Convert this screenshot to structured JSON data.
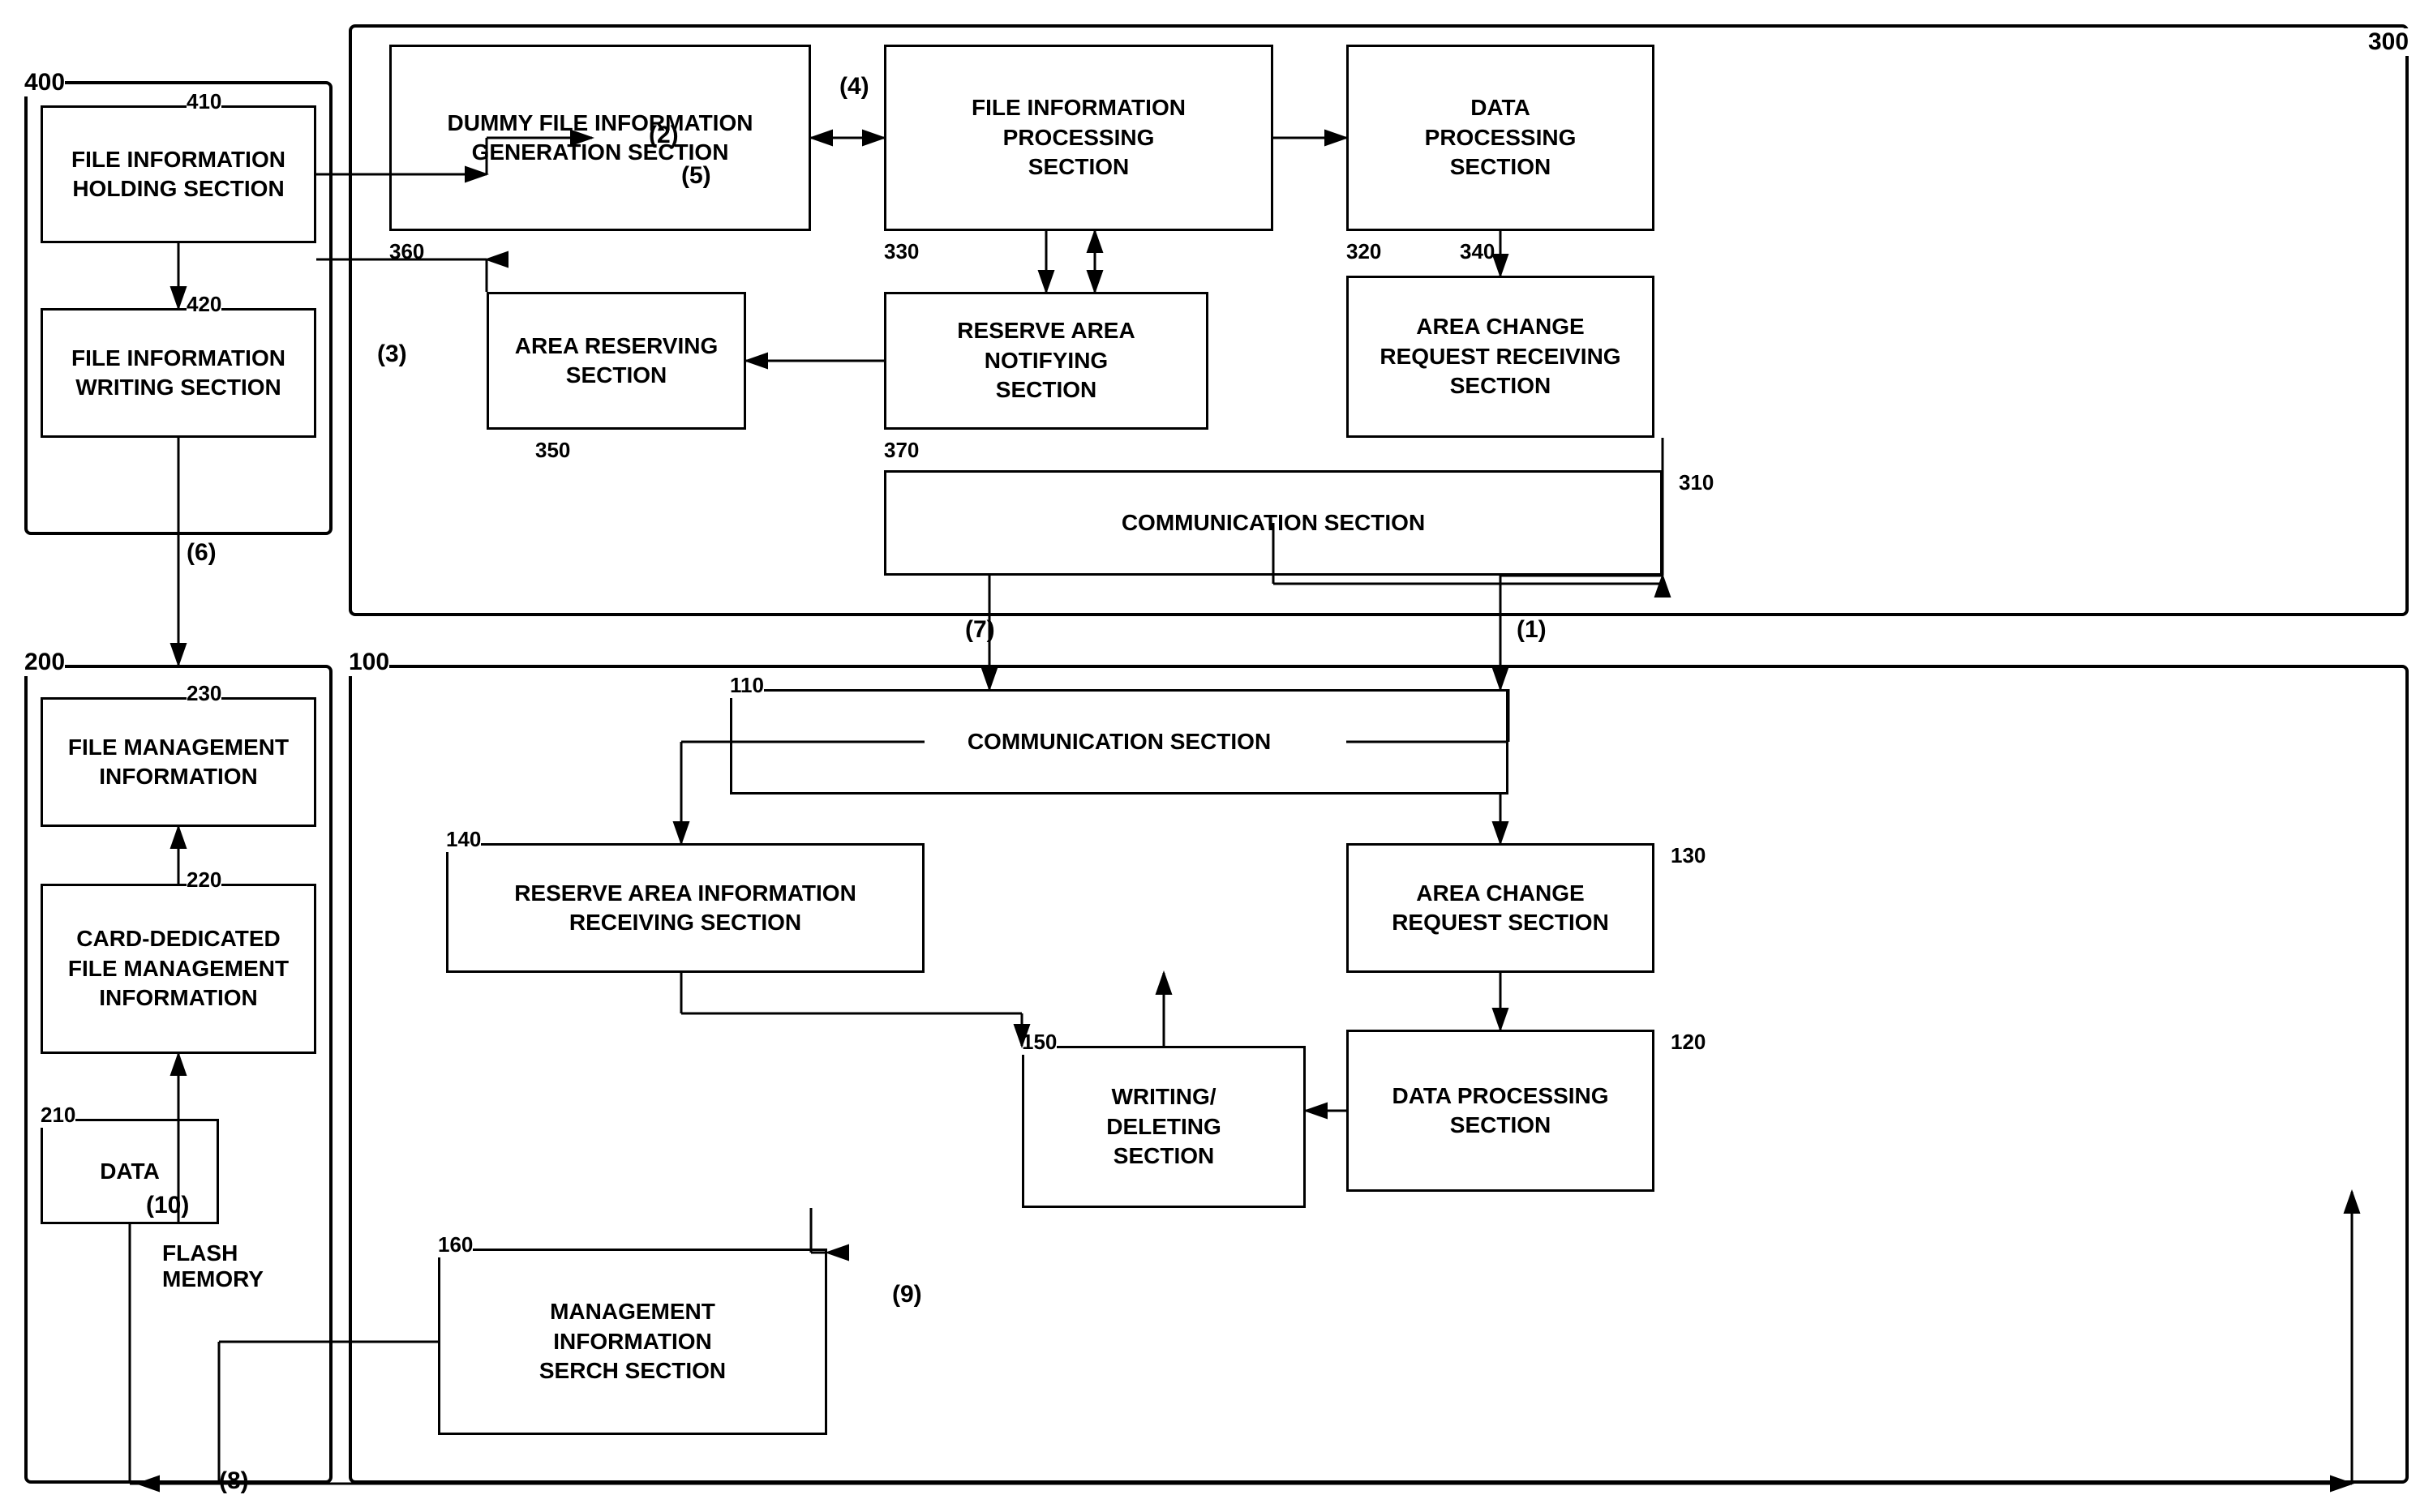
{
  "boxes": {
    "dummy_file": {
      "label": "DUMMY FILE\nINFORMATION\nGENERATION SECTION",
      "id": "360"
    },
    "file_info_processing": {
      "label": "FILE INFORMATION\nPROCESSING\nSECTION",
      "id": "330"
    },
    "data_processing_300": {
      "label": "DATA\nPROCESSING\nSECTION",
      "id": "320"
    },
    "area_reserving": {
      "label": "AREA RESERVING\nSECTION",
      "id": "350"
    },
    "reserve_area_notifying": {
      "label": "RESERVE AREA\nNOTIFYING\nSECTION",
      "id": "370"
    },
    "area_change_request_receiving": {
      "label": "AREA CHANGE\nREQUEST RECEIVING\nSECTION",
      "id": "340"
    },
    "communication_300": {
      "label": "COMMUNICATION SECTION",
      "id": "310"
    },
    "file_info_holding": {
      "label": "FILE INFORMATION\nHOLDING SECTION",
      "id": "410"
    },
    "file_info_writing": {
      "label": "FILE INFORMATION\nWRITING SECTION",
      "id": "420"
    },
    "communication_100": {
      "label": "COMMUNICATION SECTION",
      "id": "110"
    },
    "reserve_area_info_receiving": {
      "label": "RESERVE AREA INFORMATION\nRECEIVING SECTION",
      "id": "140"
    },
    "area_change_request": {
      "label": "AREA CHANGE\nREQUEST SECTION",
      "id": "130"
    },
    "writing_deleting": {
      "label": "WRITING/\nDELETING\nSECTION",
      "id": "150"
    },
    "data_processing_100": {
      "label": "DATA PROCESSING\nSECTION",
      "id": "120"
    },
    "management_info_search": {
      "label": "MANAGEMENT\nINFORMATION\nSERCH SECTION",
      "id": "160"
    },
    "file_management_info": {
      "label": "FILE MANAGEMENT\nINFORMATION",
      "id": "230"
    },
    "card_dedicated": {
      "label": "CARD-DEDICATED\nFILE MANAGEMENT\nINFORMATION",
      "id": "220"
    },
    "data": {
      "label": "DATA",
      "id": "210"
    }
  },
  "containers": {
    "c300": {
      "label": "300"
    },
    "c400": {
      "label": "400"
    },
    "c100": {
      "label": "100"
    },
    "c200": {
      "label": "200"
    }
  },
  "steps": {
    "s1": "(1)",
    "s2": "(2)",
    "s3": "(3)",
    "s4": "(4)",
    "s5": "(5)",
    "s6": "(6)",
    "s7": "(7)",
    "s8": "(8)",
    "s9": "(9)",
    "s10": "(10)"
  },
  "labels": {
    "flash_memory": "FLASH\nMEMORY"
  }
}
